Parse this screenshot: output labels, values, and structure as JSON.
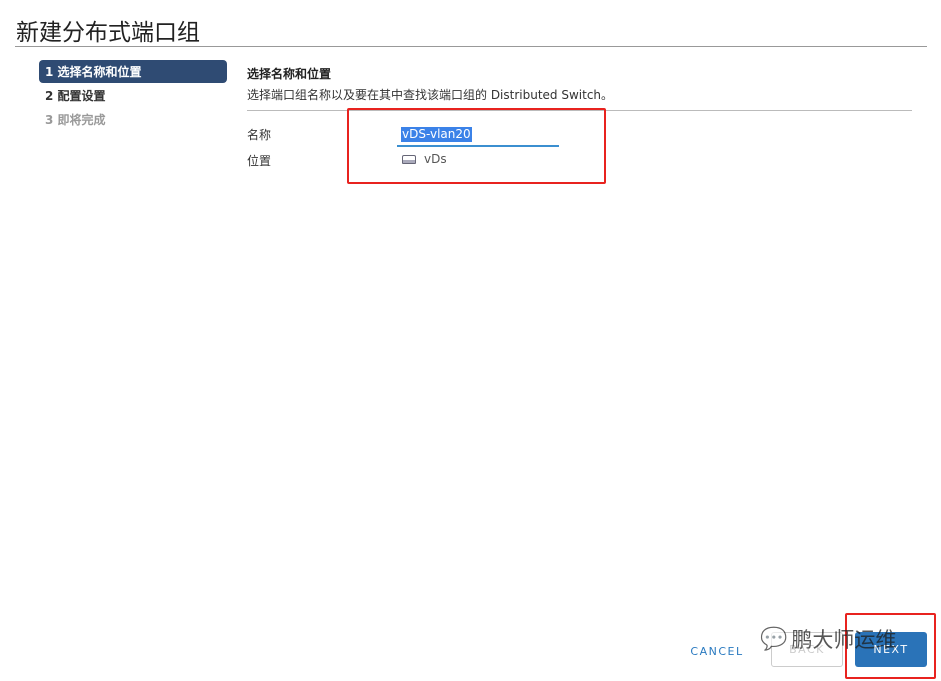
{
  "title": "新建分布式端口组",
  "steps": [
    {
      "label": "1 选择名称和位置",
      "state": "active"
    },
    {
      "label": "2 配置设置",
      "state": "pending"
    },
    {
      "label": "3 即将完成",
      "state": "disabled"
    }
  ],
  "content": {
    "heading": "选择名称和位置",
    "description": "选择端口组名称以及要在其中查找该端口组的 Distributed Switch。",
    "name_label": "名称",
    "name_value": "vDS-vlan20",
    "location_label": "位置",
    "location_value": "vDs",
    "location_icon": "distributed-switch-icon"
  },
  "footer": {
    "cancel": "CANCEL",
    "back": "BACK",
    "next": "NEXT"
  },
  "watermark": "鹏大师运维",
  "colors": {
    "accent": "#2a73b8",
    "active_step": "#2f4b73",
    "highlight": "#e8231f"
  }
}
